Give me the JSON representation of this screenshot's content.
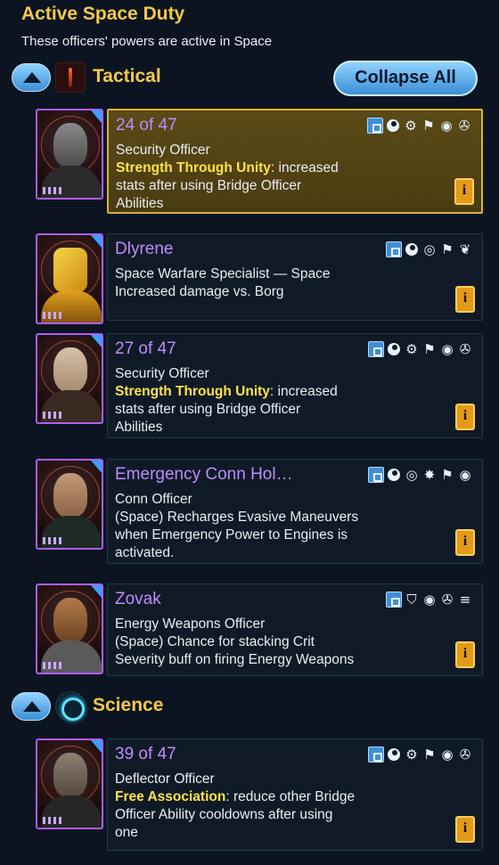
{
  "header": {
    "title": "Active Space Duty",
    "subtitle": "These officers' powers are active in Space"
  },
  "sections": {
    "tactical": {
      "label": "Tactical",
      "collapse_all": "Collapse All"
    },
    "science": {
      "label": "Science"
    }
  },
  "officers": [
    {
      "name": "24 of 47",
      "role": "Security Officer",
      "trait": "Strength Through Unity",
      "trait_rest": ": increased",
      "line2": "stats after using Bridge Officer",
      "line3": "Abilities",
      "info": "i",
      "selected": true,
      "name_color": "#c08bff"
    },
    {
      "name": "Dlyrene",
      "role": "Space Warfare Specialist — Space",
      "line1": "Increased damage vs. Borg",
      "info": "i"
    },
    {
      "name": "27 of 47",
      "role": "Security Officer",
      "trait": "Strength Through Unity",
      "trait_rest": ": increased",
      "line2": "stats after using Bridge Officer",
      "line3": "Abilities",
      "info": "i"
    },
    {
      "name": "Emergency Conn Hol…",
      "role": "Conn Officer",
      "line1": "(Space) Recharges Evasive Maneuvers",
      "line2": "when Emergency Power to Engines is",
      "line3": "activated.",
      "info": "i"
    },
    {
      "name": "Zovak",
      "role": "Energy Weapons Officer",
      "line1": "(Space) Chance for stacking Crit",
      "line2": "Severity buff on firing Energy Weapons",
      "info": "i"
    },
    {
      "name": "39 of 47",
      "role": "Deflector Officer",
      "trait": "Free Association",
      "trait_rest": ": reduce other Bridge",
      "line2": "Officer Ability cooldowns after using",
      "line3": "one",
      "info": "i"
    }
  ],
  "colors": {
    "title": "#f2c94c",
    "officer_name": "#c08bff",
    "trait": "#ffe24a",
    "accent_blue": "#3d8ed6",
    "selected_bg": "#5a4a16"
  }
}
